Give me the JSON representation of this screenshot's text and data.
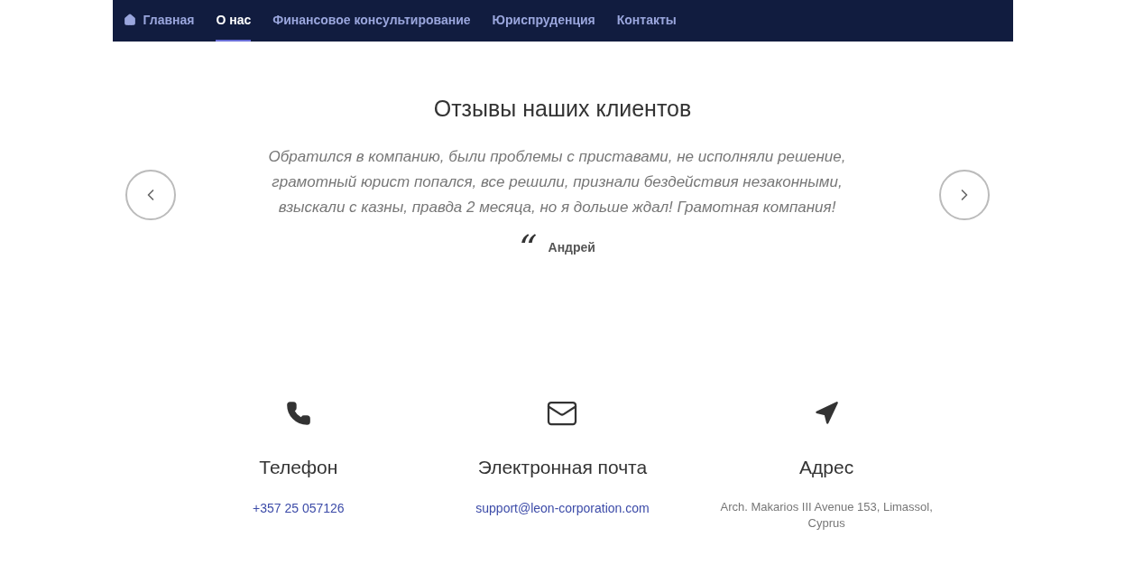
{
  "nav": [
    {
      "label": "Главная",
      "selected": false
    },
    {
      "label": "О нас",
      "selected": true
    },
    {
      "label": "Финансовое консультирование",
      "selected": false
    },
    {
      "label": "Юриспруденция",
      "selected": false
    },
    {
      "label": "Контакты",
      "selected": false
    }
  ],
  "testimonials": {
    "title": "Отзывы наших клиентов",
    "quote": "Обратился в компанию, были проблемы с приставами, не исполняли решение, грамотный юрист попался, все решили, признали бездействия незаконными, взыскали с казны, правда 2 месяца, но я дольше ждал! Грамотная компания!",
    "quote_mark": "“",
    "author": "Андрей"
  },
  "contacts": [
    {
      "kind": "phone",
      "title": "Телефон",
      "value": "+357 25 057126"
    },
    {
      "kind": "email",
      "title": "Электронная почта",
      "value": "support@leon-corporation.com"
    },
    {
      "kind": "address",
      "title": "Адрес",
      "value": "Arch. Makarios III Avenue 153, Limassol, Cyprus"
    }
  ]
}
